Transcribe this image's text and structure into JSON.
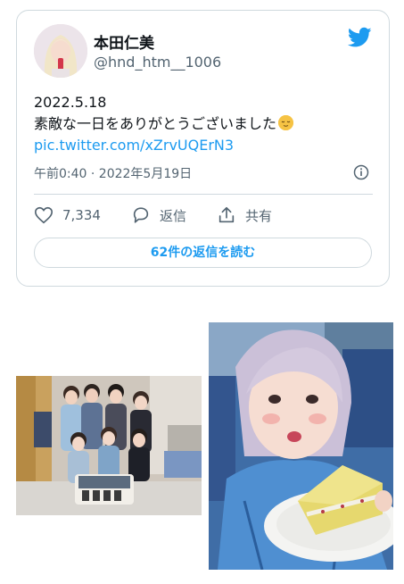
{
  "tweet": {
    "display_name": "本田仁美",
    "handle": "@hnd_htm__1006",
    "date_line": "2022.5.18",
    "text_line": "素敵な一日をありがとうございました",
    "link": "pic.twitter.com/xZrvUQErN3",
    "timestamp": "午前0:40 · 2022年5月19日",
    "likes_count": "7,334",
    "reply_label": "返信",
    "share_label": "共有",
    "read_replies_label": "62件の返信を読む"
  },
  "icons": {
    "brand": "twitter-bird-icon",
    "info": "info-icon",
    "like": "heart-icon",
    "reply": "reply-bubble-icon",
    "share": "share-icon",
    "emoji": "relieved-face-emoji"
  },
  "colors": {
    "accent": "#1d9bf0",
    "text": "#0f1419",
    "secondary": "#536471",
    "border": "#cfd9de"
  }
}
